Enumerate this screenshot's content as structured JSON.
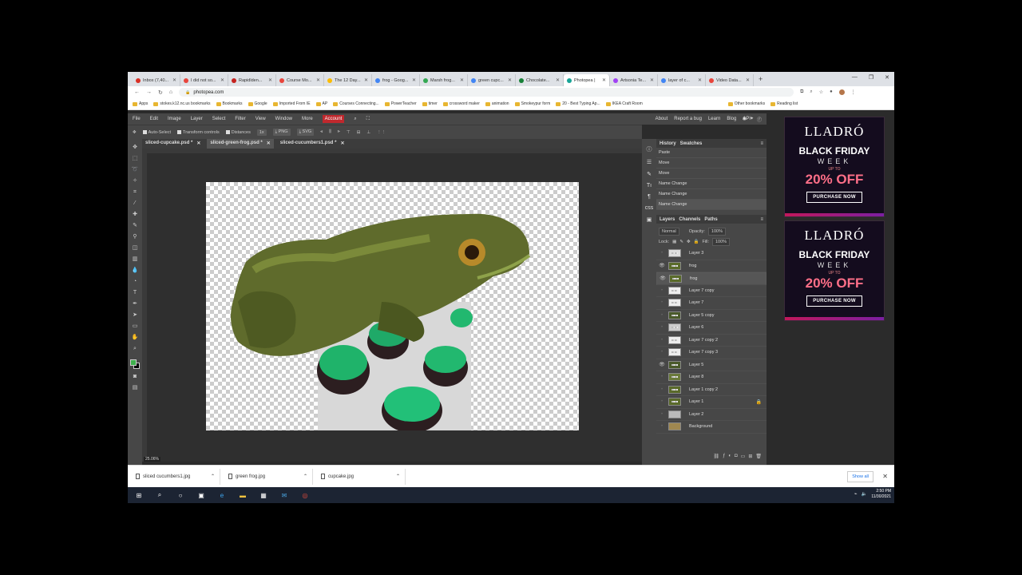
{
  "browser": {
    "tabs": [
      {
        "label": "Inbox (7,40...",
        "color": "#d93025"
      },
      {
        "label": "I did not so...",
        "color": "#e8453c"
      },
      {
        "label": "Rapidlden...",
        "color": "#c5221f"
      },
      {
        "label": "Course Mo...",
        "color": "#e8453c"
      },
      {
        "label": "The 12 Day...",
        "color": "#fbbc04"
      },
      {
        "label": "frog - Goog...",
        "color": "#4285f4"
      },
      {
        "label": "Marsh frog...",
        "color": "#34a853"
      },
      {
        "label": "green cupc...",
        "color": "#4285f4"
      },
      {
        "label": "Chocolate...",
        "color": "#188038"
      },
      {
        "label": "Photopea |",
        "color": "#18a497",
        "active": true
      },
      {
        "label": "Artsonia Te...",
        "color": "#a142f4"
      },
      {
        "label": "layer of c...",
        "color": "#4285f4"
      },
      {
        "label": "Video Data...",
        "color": "#e8453c"
      }
    ],
    "new_tab": "+",
    "window_controls": [
      "—",
      "❐",
      "✕"
    ],
    "url": "photopea.com",
    "bookmarks": [
      "Apps",
      "stokes.k12.nc.us bookmarks",
      "Bookmarks",
      "Google",
      "Imported From IE",
      "AP",
      "Courses Connecting...",
      "PowerTeacher",
      "timer",
      "crossword maker",
      "animation",
      "Smokeypur form",
      "20 - Best Typing Ap...",
      "IKEA Craft Room",
      "Other bookmarks",
      "Reading list"
    ]
  },
  "app": {
    "menu": [
      "File",
      "Edit",
      "Image",
      "Layer",
      "Select",
      "Filter",
      "View",
      "Window",
      "More"
    ],
    "account_label": "Account",
    "right_links": [
      "About",
      "Report a bug",
      "Learn",
      "Blog",
      "API"
    ],
    "options": {
      "auto_select": "Auto-Select",
      "transform": "Transform controls",
      "distances": "Distances",
      "zoom": "1x",
      "png": "PNG",
      "svg": "SVG"
    },
    "doc_tabs": [
      {
        "label": "sliced-cupcake.psd *",
        "active": false
      },
      {
        "label": "sliced-green-frog.psd *",
        "active": true
      },
      {
        "label": "sliced-cucumbers1.psd *",
        "active": false
      }
    ],
    "zoom_readout": "25.06%",
    "history": {
      "tabs": [
        "History",
        "Swatches"
      ],
      "items": [
        "Paste",
        "Move",
        "Move",
        "Name Change",
        "Name Change",
        "Name Change"
      ]
    },
    "layers_panel": {
      "tabs": [
        "Layers",
        "Channels",
        "Paths"
      ],
      "blend_mode": "Normal",
      "opacity_label": "Opacity:",
      "opacity": "100%",
      "lock_label": "Lock:",
      "fill_label": "Fill:",
      "fill": "100%",
      "layers": [
        {
          "name": "Layer 3",
          "visible": false,
          "thumb": "#ddd"
        },
        {
          "name": "frog",
          "visible": true,
          "thumb": "#5a6b2a"
        },
        {
          "name": "frog",
          "visible": true,
          "thumb": "#5a6b2a",
          "selected": true
        },
        {
          "name": "Layer 7 copy",
          "visible": false,
          "thumb": "#eee"
        },
        {
          "name": "Layer 7",
          "visible": false,
          "thumb": "#eee"
        },
        {
          "name": "Layer 5 copy",
          "visible": false,
          "thumb": "#4a5a2a"
        },
        {
          "name": "Layer 6",
          "visible": false,
          "thumb": "#ccc"
        },
        {
          "name": "Layer 7 copy 2",
          "visible": false,
          "thumb": "#eee"
        },
        {
          "name": "Layer 7 copy 3",
          "visible": false,
          "thumb": "#eee"
        },
        {
          "name": "Layer 5",
          "visible": true,
          "thumb": "#4a5a2a"
        },
        {
          "name": "Layer 8",
          "visible": false,
          "thumb": "#6a7a3a"
        },
        {
          "name": "Layer 1 copy 2",
          "visible": false,
          "thumb": "#5a6a2a"
        },
        {
          "name": "Layer 1",
          "visible": false,
          "thumb": "#5a6a2a",
          "locked": true
        },
        {
          "name": "Layer 2",
          "visible": false,
          "thumb": "#bbb",
          "solid": true
        },
        {
          "name": "Background",
          "visible": false,
          "thumb": "#a08850",
          "solid": true
        }
      ]
    }
  },
  "ads": [
    {
      "brand": "LLADRÓ",
      "headline": "BLACK FRIDAY",
      "week": "WEEK",
      "upto": "UP TO",
      "offer": "20% OFF",
      "cta": "PURCHASE NOW"
    },
    {
      "brand": "LLADRÓ",
      "headline": "BLACK FRIDAY",
      "week": "WEEK",
      "upto": "UP TO",
      "offer": "20% OFF",
      "cta": "PURCHASE NOW"
    }
  ],
  "downloads": {
    "items": [
      "sliced cucumbers1.jpg",
      "green frog.jpg",
      "cupcake.jpg"
    ],
    "show_all": "Show all"
  },
  "taskbar": {
    "time": "2:50 PM",
    "date": "11/30/2021"
  }
}
